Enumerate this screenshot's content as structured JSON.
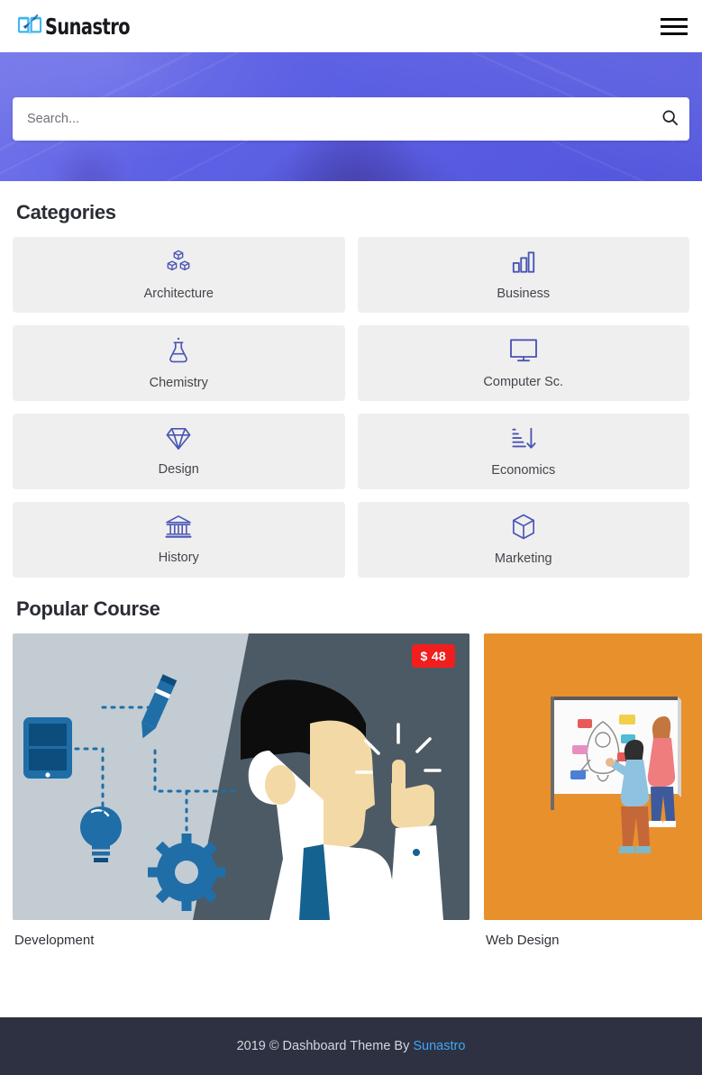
{
  "header": {
    "logo_text": "Sunastro",
    "logo_icon": "book-pen-icon",
    "menu_icon": "hamburger-menu-icon"
  },
  "search": {
    "placeholder": "Search...",
    "value": "",
    "icon": "search-icon"
  },
  "categories": {
    "title": "Categories",
    "items": [
      {
        "label": "Architecture",
        "icon": "cubes-icon"
      },
      {
        "label": "Business",
        "icon": "bar-chart-icon"
      },
      {
        "label": "Chemistry",
        "icon": "flask-icon"
      },
      {
        "label": "Computer Sc.",
        "icon": "desktop-monitor-icon"
      },
      {
        "label": "Design",
        "icon": "diamond-gem-icon"
      },
      {
        "label": "Economics",
        "icon": "sort-amount-down-icon"
      },
      {
        "label": "History",
        "icon": "bank-building-icon"
      },
      {
        "label": "Marketing",
        "icon": "3d-box-icon"
      }
    ]
  },
  "popular": {
    "title": "Popular Course",
    "courses": [
      {
        "name": "Development",
        "price": "$ 48",
        "has_price": true
      },
      {
        "name": "Web Design",
        "price": "",
        "has_price": false
      }
    ]
  },
  "footer": {
    "text": "2019 © Dashboard Theme By ",
    "link": "Sunastro"
  },
  "colors": {
    "hero": "#5b5fe3",
    "accent": "#4a56b5",
    "price_badge": "#f01e1e",
    "footer_bg": "#2d3142",
    "footer_link": "#3fa8f4",
    "card_bg": "#efefef"
  }
}
